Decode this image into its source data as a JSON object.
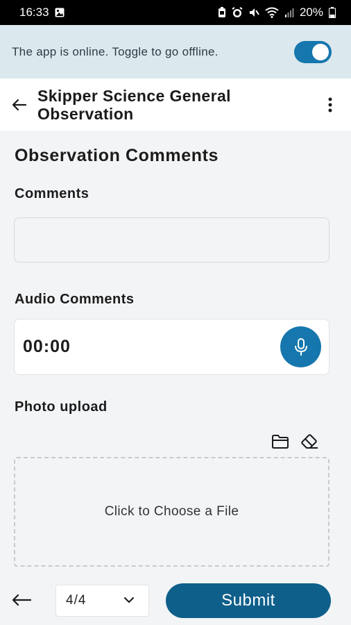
{
  "status_bar": {
    "time": "16:33",
    "battery": "20%"
  },
  "banner": {
    "message": "The app is online. Toggle to go  offline.",
    "toggle_on": true
  },
  "app_bar": {
    "title": "Skipper Science General Observation"
  },
  "form": {
    "section_title": "Observation Comments",
    "comments_label": "Comments",
    "comments_value": "",
    "audio_label": "Audio Comments",
    "audio_timer": "00:00",
    "photo_label": "Photo upload",
    "dropzone_text": "Click to Choose a File"
  },
  "footer": {
    "page_value": "4/4",
    "submit_label": "Submit"
  },
  "colors": {
    "primary": "#1577ad",
    "submit": "#0e5f8a",
    "banner_bg": "#dbe8ee"
  }
}
